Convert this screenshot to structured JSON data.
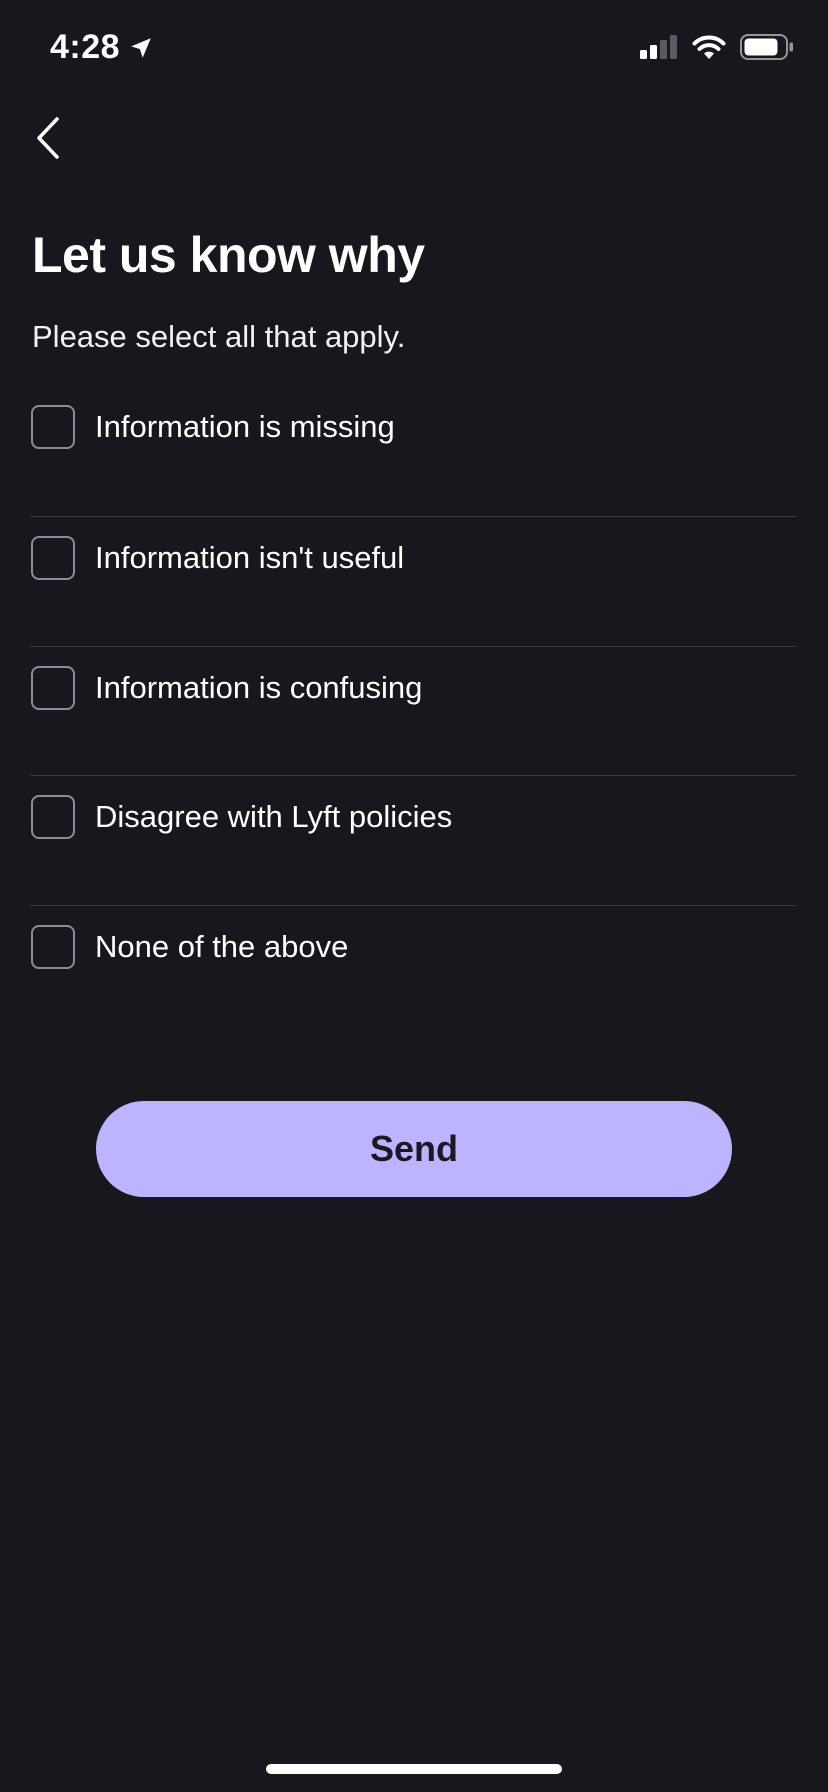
{
  "status_bar": {
    "time": "4:28",
    "location_icon": "location-arrow-icon",
    "signal_icon": "cellular-signal-icon",
    "wifi_icon": "wifi-icon",
    "battery_icon": "battery-icon"
  },
  "nav": {
    "back_icon": "chevron-left-icon"
  },
  "page": {
    "title": "Let us know why",
    "subtitle": "Please select all that apply."
  },
  "options": [
    {
      "label": "Information is missing",
      "checked": false
    },
    {
      "label": "Information isn't useful",
      "checked": false
    },
    {
      "label": "Information is confusing",
      "checked": false
    },
    {
      "label": "Disagree with Lyft policies",
      "checked": false
    },
    {
      "label": "None of the above",
      "checked": false
    }
  ],
  "actions": {
    "send_label": "Send"
  },
  "colors": {
    "background": "#17171e",
    "accent": "#bdb4ff",
    "divider": "#3d3d47",
    "checkbox_border": "#8c8c96"
  }
}
